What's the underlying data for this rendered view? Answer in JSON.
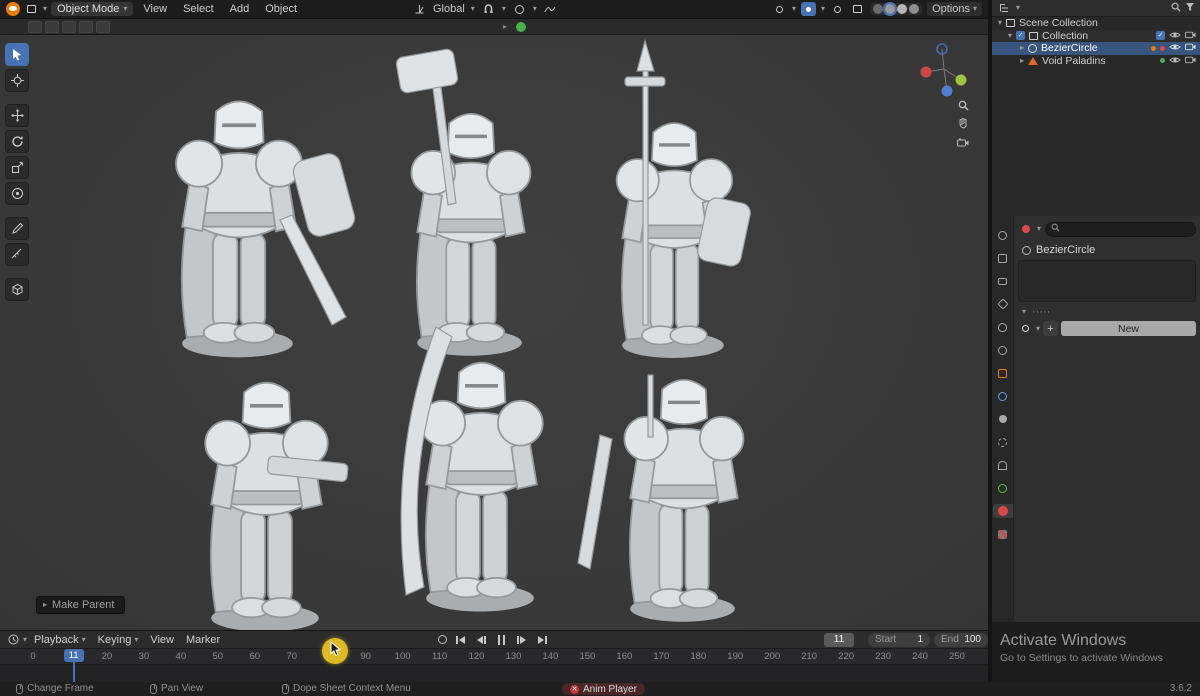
{
  "icons": {
    "chevron_down": "▾",
    "chevron_right": "▸",
    "plus": "+",
    "close": "✕",
    "check": "✓",
    "dots_row": "·····"
  },
  "topbar": {
    "mode_select": "Object Mode",
    "menus": [
      "View",
      "Select",
      "Add",
      "Object"
    ],
    "orientation": "Global",
    "options_label": "Options"
  },
  "viewport": {
    "operator_panel_label": "Make Parent"
  },
  "outliner": {
    "rows": [
      {
        "label": "Scene Collection"
      },
      {
        "label": "Collection"
      },
      {
        "label": "BezierCircle"
      },
      {
        "label": "Void Paladins"
      }
    ]
  },
  "properties": {
    "object_name": "BezierCircle",
    "new_button_label": "New"
  },
  "timeline": {
    "menus": [
      "Playback",
      "Keying",
      "View",
      "Marker"
    ],
    "current_frame": "11",
    "playhead_frame": 11,
    "start_label": "Start",
    "start_value": "1",
    "end_label": "End",
    "end_value": "100",
    "ticks": [
      0,
      20,
      30,
      40,
      50,
      60,
      70,
      80,
      90,
      100,
      110,
      120,
      130,
      140,
      150,
      160,
      170,
      180,
      190,
      200,
      210,
      220,
      230,
      240,
      250
    ]
  },
  "statusbar": {
    "left_items": [
      "Change Frame",
      "Pan View",
      "Dope Sheet Context Menu"
    ],
    "anim_player_label": "Anim Player",
    "version": "3.6.2"
  },
  "watermark": {
    "title": "Activate Windows",
    "subtitle": "Go to Settings to activate Windows"
  }
}
